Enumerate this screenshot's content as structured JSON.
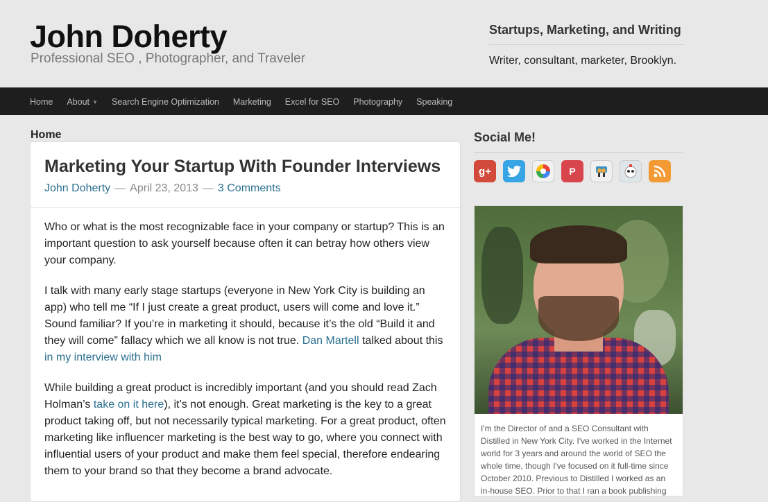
{
  "site": {
    "title": "John Doherty",
    "description": "Professional SEO , Photographer, and Traveler"
  },
  "header_widget": {
    "title": "Startups, Marketing, and Writing",
    "text": "Writer, consultant, marketer, Brooklyn."
  },
  "nav": {
    "items": [
      {
        "label": "Home"
      },
      {
        "label": "About",
        "has_submenu": true
      },
      {
        "label": "Search Engine Optimization"
      },
      {
        "label": "Marketing"
      },
      {
        "label": "Excel for SEO"
      },
      {
        "label": "Photography"
      },
      {
        "label": "Speaking"
      }
    ]
  },
  "breadcrumb": "Home",
  "post": {
    "title": "Marketing Your Startup With Founder Interviews",
    "author": "John Doherty",
    "separator": "—",
    "date": "April 23, 2013",
    "comments": "3 Comments",
    "p1": "Who or what is the most recognizable face in your company or startup? This is an important question to ask yourself because often it can betray how others view your company.",
    "p2_a": "I talk with many early stage startups (everyone in New York City is building an app) who tell me “If I just create a great product, users will come and love it.” Sound familiar? If you’re in marketing it should, because it’s the old “Build it and they will come” fallacy which we all know is not true. ",
    "p2_link1": "Dan Martell",
    "p2_b": " talked about this ",
    "p2_link2": "in my interview with him",
    "p3_a": "While building a great product is incredibly important (and you should read Zach Holman’s ",
    "p3_link": "take on it here",
    "p3_b": "), it’s not enough. Great marketing is the key to a great product taking off, but not necessarily typical marketing. For a great product, often marketing like influencer marketing is the best way to go, where you connect with influential users of your product and make them feel special, therefore endearing them to your brand so that they become a brand advocate."
  },
  "sidebar": {
    "social_title": "Social Me!",
    "social_icons": [
      {
        "name": "google-plus-icon",
        "glyph": "g+",
        "color": "#d24a3b"
      },
      {
        "name": "twitter-icon",
        "glyph": "t",
        "color": "#36a4e5"
      },
      {
        "name": "picasa-icon",
        "glyph": "◐",
        "color": "#f2f2f2"
      },
      {
        "name": "pinterest-icon",
        "glyph": "P",
        "color": "#d9454d"
      },
      {
        "name": "slideshare-icon",
        "glyph": "▣",
        "color": "#f0f0f0"
      },
      {
        "name": "hootsuite-icon",
        "glyph": "◉",
        "color": "#dfe6ea"
      },
      {
        "name": "rss-icon",
        "glyph": "◔",
        "color": "#f49a34"
      }
    ],
    "bio": "I'm the Director of and a SEO Consultant with Distilled in New York City. I've worked in the Internet world for 3 years and around the world of SEO the whole time, though I've focused on it full-time since October 2010. Previous to Distilled I worked as an in-house SEO. Prior to that I ran a book publishing"
  },
  "colors": {
    "background": "#e8e8e8",
    "nav_bg": "#1e1e1e",
    "link": "#2a6f8f"
  }
}
